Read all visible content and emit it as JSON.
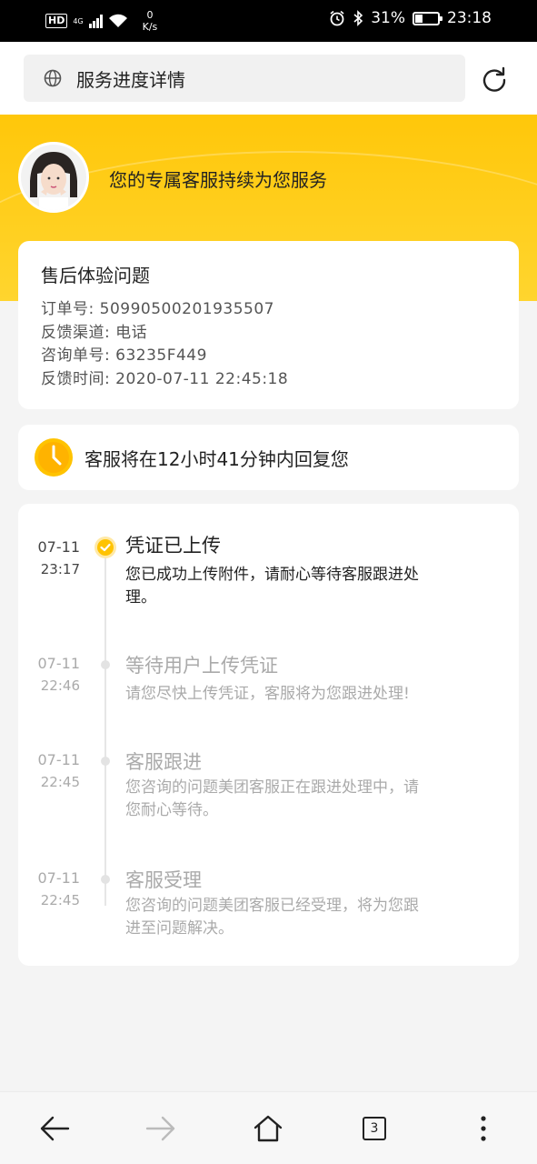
{
  "status_bar": {
    "hd": "HD",
    "network_type": "4G",
    "net_speed": "0",
    "net_unit": "K/s",
    "battery_percent": "31%",
    "battery_level": 0.31,
    "time": "23:18"
  },
  "address_bar": {
    "title": "服务进度详情",
    "icons": [
      "globe-icon",
      "refresh-icon"
    ]
  },
  "banner": {
    "text": "您的专属客服持续为您服务",
    "accent": "#ffc70a"
  },
  "info_card": {
    "title": "售后体验问题",
    "lines": [
      "订单号: 50990500201935507",
      "反馈渠道: 电话",
      "咨询单号: 63235F449",
      "反馈时间: 2020-07-11 22:45:18"
    ]
  },
  "reply_card": {
    "text": "客服将在12小时41分钟内回复您",
    "icon": "clock-icon"
  },
  "timeline": {
    "items": [
      {
        "date": "07-11",
        "time": "23:17",
        "title": "凭证已上传",
        "desc_lines": [
          "您已成功上传附件，请耐心等待客服跟进处",
          "理。"
        ],
        "active": true
      },
      {
        "date": "07-11",
        "time": "22:46",
        "title": "等待用户上传凭证",
        "desc_lines": [
          "请您尽快上传凭证，客服将为您跟进处理!"
        ],
        "active": false
      },
      {
        "date": "07-11",
        "time": "22:45",
        "title": "客服跟进",
        "desc_lines": [
          "您咨询的问题美团客服正在跟进处理中，请",
          "您耐心等待。"
        ],
        "active": false
      },
      {
        "date": "07-11",
        "time": "22:45",
        "title": "客服受理",
        "desc_lines": [
          "您咨询的问题美团客服已经受理，将为您跟",
          "进至问题解决。"
        ],
        "active": false
      }
    ]
  },
  "bottom_nav": {
    "tab_count": "3",
    "icons": [
      "back-arrow-icon",
      "forward-arrow-icon",
      "home-icon",
      "tabs-icon",
      "more-icon"
    ]
  }
}
